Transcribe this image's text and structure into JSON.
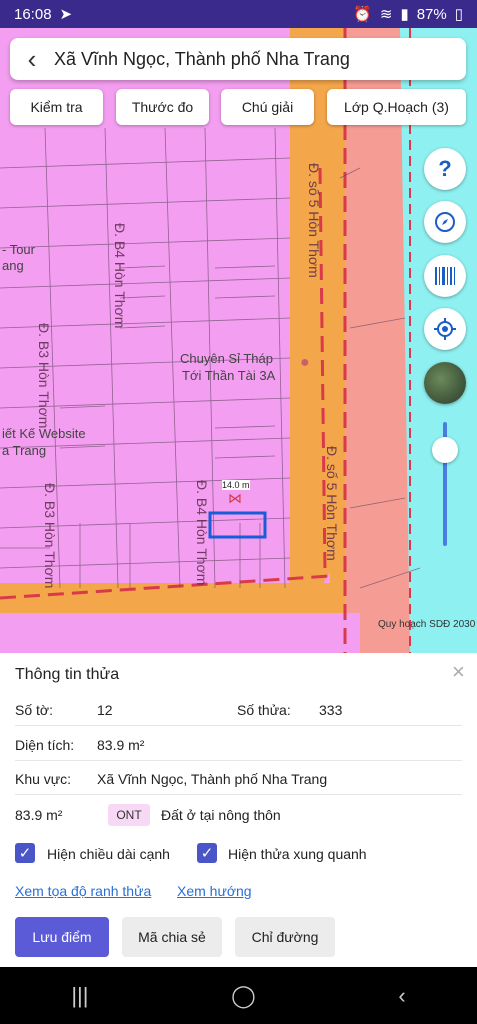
{
  "status": {
    "time": "16:08",
    "battery": "87%"
  },
  "search": {
    "location": "Xã Vĩnh Ngọc, Thành phố Nha Trang"
  },
  "chips": [
    {
      "label": "Kiểm tra"
    },
    {
      "label": "Thước đo"
    },
    {
      "label": "Chú giải"
    },
    {
      "label": "Lớp Q.Hoạch (3)"
    }
  ],
  "map": {
    "streets": {
      "b4_top": "Đ. B4 Hòn Thơm",
      "b4_bottom": "Đ. B4 Hòn Thơm",
      "b3": "Đ. B3 Hòn Thơm",
      "so5_top": "Đ. số 5 Hòn Thơm",
      "so5_bottom": "Đ. số 5 Hòn Thơm"
    },
    "poi_tour": "- Tour",
    "poi_tour2": "ang",
    "poi_shop_line1": "Chuyên Sỉ Tháp",
    "poi_shop_line2": "Tới Thần Tài 3A",
    "poi_web_line1": "iết Kế Website",
    "poi_web_line2": "a Trang",
    "measure": "14.0 m",
    "watermark": "Quy hoạch SDĐ 2030",
    "help_icon": "?"
  },
  "info": {
    "title": "Thông tin thửa",
    "so_to_label": "Số tờ:",
    "so_to_value": "12",
    "so_thua_label": "Số thửa:",
    "so_thua_value": "333",
    "dien_tich_label": "Diện tích:",
    "dien_tich_value": "83.9 m²",
    "khu_vuc_label": "Khu vực:",
    "khu_vuc_value": "Xã Vĩnh Ngọc, Thành phố Nha Trang",
    "area_value": "83.9 m²",
    "land_code": "ONT",
    "land_desc": "Đất ở tại nông thôn",
    "check1": "Hiện chiều dài cạnh",
    "check2": "Hiện thửa xung quanh",
    "link1": "Xem tọa độ ranh thửa",
    "link2": "Xem hướng",
    "btn_save": "Lưu điểm",
    "btn_share": "Mã chia sẻ",
    "btn_direction": "Chỉ đường"
  }
}
